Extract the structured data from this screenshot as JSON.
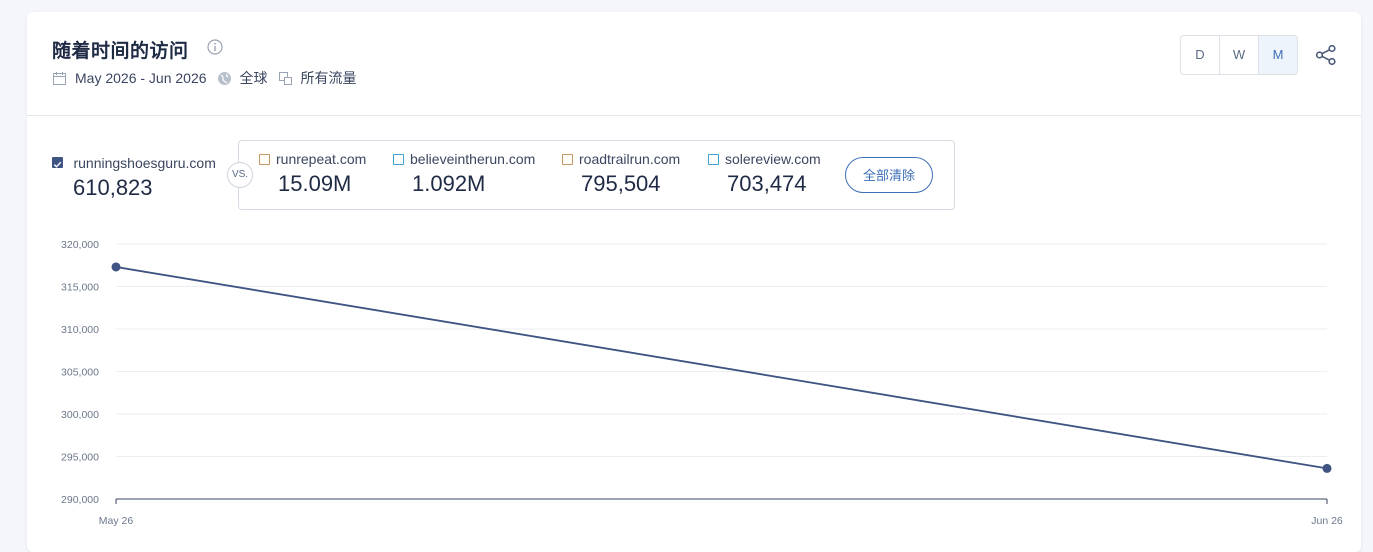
{
  "header": {
    "title": "随着时间的访问",
    "date_range": "May 2026 - Jun 2026",
    "region": "全球",
    "traffic": "所有流量",
    "granularity": [
      "D",
      "W",
      "M"
    ]
  },
  "primary": {
    "name": "runningshoesguru.com",
    "value": "610,823",
    "color": "#3f5482"
  },
  "vs_label": "VS.",
  "competitors": [
    {
      "name": "runrepeat.com",
      "value": "15.09M",
      "color": "#c8955c"
    },
    {
      "name": "believeintherun.com",
      "value": "1.092M",
      "color": "#3ea0d4"
    },
    {
      "name": "roadtrailrun.com",
      "value": "795,504",
      "color": "#c8955c"
    },
    {
      "name": "solereview.com",
      "value": "703,474",
      "color": "#3ea0d4"
    }
  ],
  "clear_all": "全部清除",
  "chart_data": {
    "type": "line",
    "x": [
      "May 26",
      "Jun 26"
    ],
    "series": [
      {
        "name": "runningshoesguru.com",
        "values": [
          317300,
          293600
        ],
        "color": "#3f5482"
      }
    ],
    "ylim": [
      290000,
      320000
    ],
    "yticks": [
      320000,
      315000,
      310000,
      305000,
      300000,
      295000,
      290000
    ],
    "ytick_labels": [
      "320,000",
      "315,000",
      "310,000",
      "305,000",
      "300,000",
      "295,000",
      "290,000"
    ],
    "grid": true
  }
}
